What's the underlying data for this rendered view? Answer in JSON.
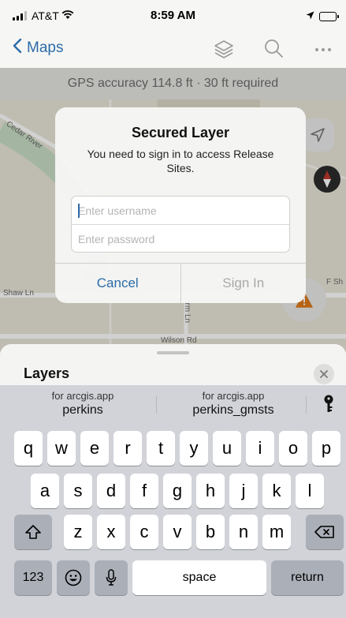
{
  "status_bar": {
    "carrier": "AT&T",
    "time": "8:59 AM"
  },
  "nav": {
    "back_label": "Maps"
  },
  "gps_banner": {
    "text": "GPS accuracy 114.8 ft · 30 ft required"
  },
  "map": {
    "labels": {
      "cedar_river": "Cedar River",
      "shaw_ln": "Shaw Ln",
      "wilson_rd": "Wilson Rd",
      "arm_ln": "arm Ln",
      "f_sh": "F Sh"
    }
  },
  "alert": {
    "title": "Secured Layer",
    "message": "You need to sign in to access Release Sites.",
    "username_placeholder": "Enter username",
    "password_placeholder": "Enter password",
    "cancel_label": "Cancel",
    "signin_label": "Sign In"
  },
  "layers": {
    "title": "Layers"
  },
  "keyboard": {
    "suggestions": [
      {
        "top": "for arcgis.app",
        "main": "perkins"
      },
      {
        "top": "for arcgis.app",
        "main": "perkins_gmsts"
      }
    ],
    "row1": [
      "q",
      "w",
      "e",
      "r",
      "t",
      "y",
      "u",
      "i",
      "o",
      "p"
    ],
    "row2": [
      "a",
      "s",
      "d",
      "f",
      "g",
      "h",
      "j",
      "k",
      "l"
    ],
    "row3": [
      "z",
      "x",
      "c",
      "v",
      "b",
      "n",
      "m"
    ],
    "numbers_label": "123",
    "space_label": "space",
    "return_label": "return"
  },
  "colors": {
    "accent": "#2c6ba8",
    "warning": "#e07a1c",
    "compass_red": "#c0392b"
  }
}
